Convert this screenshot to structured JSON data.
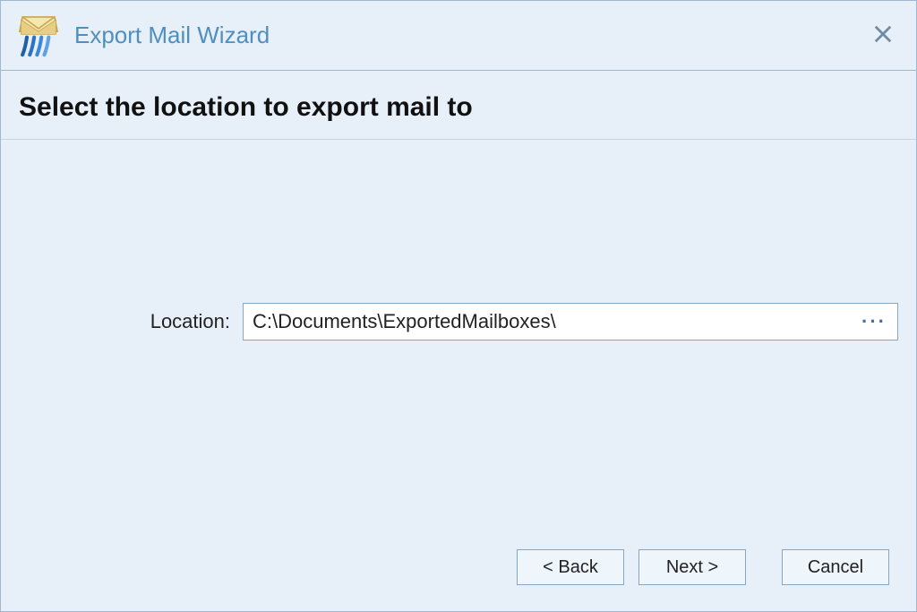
{
  "window": {
    "title": "Export Mail Wizard"
  },
  "page": {
    "heading": "Select the location to export mail to"
  },
  "form": {
    "location_label": "Location:",
    "location_value": "C:\\Documents\\ExportedMailboxes\\",
    "browse_label": "···"
  },
  "buttons": {
    "back": "< Back",
    "next": "Next >",
    "cancel": "Cancel"
  }
}
